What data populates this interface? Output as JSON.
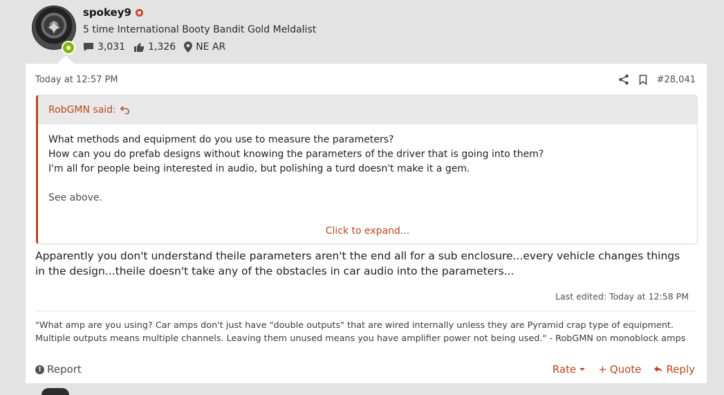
{
  "user": {
    "name": "spokey9",
    "title": "5 time International Booty Bandit Gold Meldalist",
    "messages": "3,031",
    "reactions": "1,326",
    "location": "NE AR"
  },
  "post": {
    "date": "Today at 12:57 PM",
    "number": "#28,041",
    "quote": {
      "author_label": "RobGMN said:",
      "lines": [
        "What methods and equipment do you use to measure the parameters?",
        "How can you do prefab designs without knowing the parameters of the driver that is going into them?",
        "I'm all for people being interested in audio, but polishing a turd doesn't make it a gem."
      ],
      "see_above": "See above.",
      "expand": "Click to expand..."
    },
    "body": "Apparently you don't understand theile parameters aren't the end all for a sub enclosure...every vehicle changes things in the design...theile doesn't take any of the obstacles in car audio into the parameters...",
    "last_edited": "Last edited: Today at 12:58 PM",
    "signature_line1": "\"What amp are you using? Car amps don't just have \"double outputs\" that are wired internally unless they are Pyramid crap type of equipment.",
    "signature_line2": "Multiple outputs means multiple channels. Leaving them unused means you have amplifier power not being used.\" - RobGMN on monoblock amps"
  },
  "actions": {
    "report": "Report",
    "rate": "Rate",
    "quote": "Quote",
    "reply": "Reply"
  },
  "colors": {
    "accent": "#b9461e",
    "online": "#7fb900",
    "page_bg": "#e3e3e3"
  },
  "icons": [
    "comments-icon",
    "thumbs-up-icon",
    "location-pin-icon",
    "share-icon",
    "bookmark-icon",
    "back-arrow-icon",
    "report-icon",
    "chevron-down-icon",
    "plus-icon",
    "reply-icon"
  ]
}
